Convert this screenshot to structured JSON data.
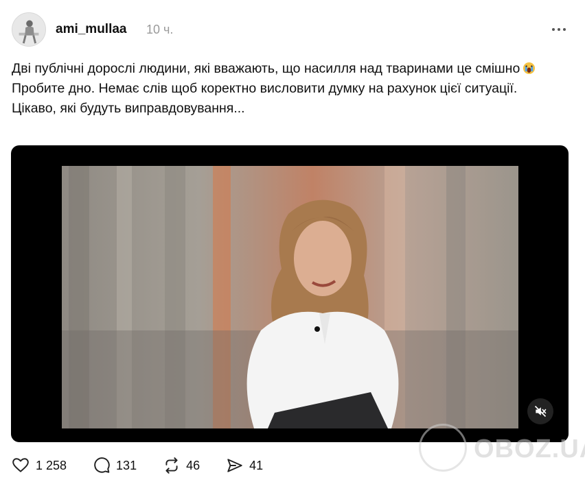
{
  "post": {
    "username": "ami_mullaa",
    "time": "10 ч.",
    "text_line1": "Дві публічні дорослі людини, які вважають, що насилля над тваринами це смішно",
    "text_line2": "Пробите дно. Немає слів щоб коректно висловити думку на рахунок цієї ситуації.",
    "text_line3": "Цікаво, які будуть виправдовування..."
  },
  "icons": {
    "more": "more-horizontal-icon",
    "emoji": "crying-face-emoji",
    "mute": "speaker-muted-icon",
    "like": "heart-icon",
    "comment": "comment-bubble-icon",
    "repost": "repost-icon",
    "share": "send-icon"
  },
  "actions": {
    "likes": "1 258",
    "comments": "131",
    "reposts": "46",
    "shares": "41"
  },
  "watermark": {
    "text": "OBOZ.UA"
  },
  "colors": {
    "text": "#101010",
    "muted": "#9a9a9a",
    "background": "#ffffff"
  }
}
